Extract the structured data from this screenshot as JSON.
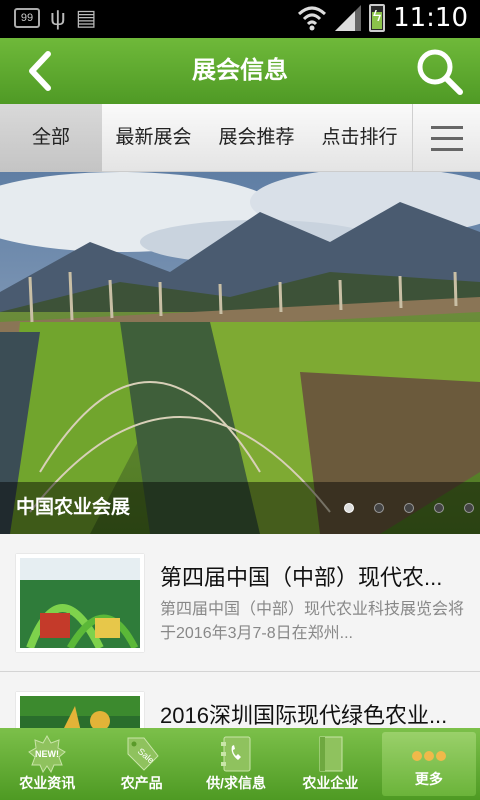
{
  "status_bar": {
    "notification_badge": "99",
    "time": "11:10"
  },
  "header": {
    "title": "展会信息"
  },
  "tabs": [
    {
      "label": "全部",
      "active": true
    },
    {
      "label": "最新展会",
      "active": false
    },
    {
      "label": "展会推荐",
      "active": false
    },
    {
      "label": "点击排行",
      "active": false
    }
  ],
  "banner": {
    "caption": "中国农业会展",
    "slide_count": 5,
    "active_slide": 1
  },
  "list": [
    {
      "title": "第四届中国（中部）现代农...",
      "desc": "第四届中国（中部）现代农业科技展览会将于2016年3月7-8日在郑州..."
    },
    {
      "title": "2016深圳国际现代绿色农业...",
      "desc": ""
    }
  ],
  "bottom_nav": [
    {
      "label": "农业资讯",
      "icon": "new-badge-icon",
      "badge_text": "NEW!"
    },
    {
      "label": "农产品",
      "icon": "sale-tag-icon",
      "badge_text": "Sale"
    },
    {
      "label": "供/求信息",
      "icon": "phone-book-icon"
    },
    {
      "label": "农业企业",
      "icon": "book-icon"
    },
    {
      "label": "更多",
      "icon": "more-dots-icon",
      "active": true
    }
  ],
  "colors": {
    "brand_green": "#5aa82e",
    "nav_green": "#4e9a23"
  }
}
